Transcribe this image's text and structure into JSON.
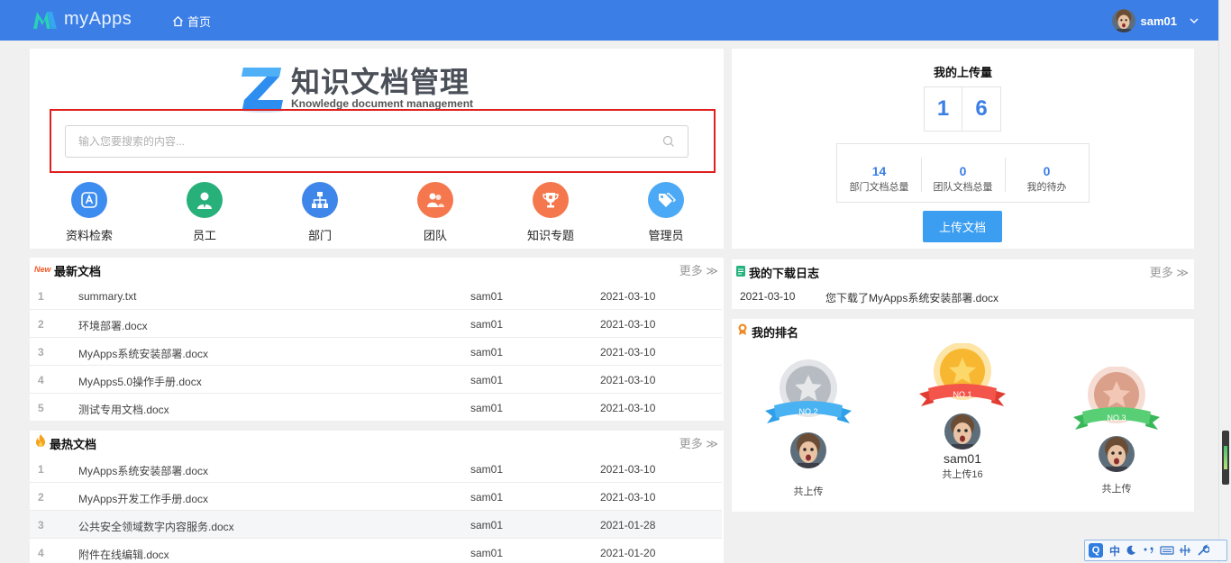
{
  "app": {
    "name": "myApps"
  },
  "nav": {
    "home": "首页"
  },
  "user": {
    "name": "sam01"
  },
  "brand": {
    "title": "知识文档管理",
    "subtitle": "Knowledge document management"
  },
  "search": {
    "placeholder": "输入您要搜索的内容..."
  },
  "categories": [
    {
      "label": "资料检索",
      "icon": "letter-a-icon",
      "color": "#3d8cef"
    },
    {
      "label": "员工",
      "icon": "employee-icon",
      "color": "#28b07a"
    },
    {
      "label": "部门",
      "icon": "org-chart-icon",
      "color": "#3f86ea"
    },
    {
      "label": "团队",
      "icon": "team-icon",
      "color": "#f4774d"
    },
    {
      "label": "知识专题",
      "icon": "trophy-icon",
      "color": "#f4774d"
    },
    {
      "label": "管理员",
      "icon": "tags-icon",
      "color": "#4ba9f5"
    }
  ],
  "upload": {
    "title": "我的上传量",
    "digits": [
      "1",
      "6"
    ],
    "stats": [
      {
        "value": "14",
        "label": "部门文档总量"
      },
      {
        "value": "0",
        "label": "团队文档总量"
      },
      {
        "value": "0",
        "label": "我的待办"
      }
    ],
    "button": "上传文档"
  },
  "latest": {
    "badge": "New",
    "title": "最新文档",
    "more": "更多",
    "rows": [
      {
        "idx": "1",
        "name": "summary.txt",
        "owner": "sam01",
        "date": "2021-03-10"
      },
      {
        "idx": "2",
        "name": "环境部署.docx",
        "owner": "sam01",
        "date": "2021-03-10"
      },
      {
        "idx": "3",
        "name": "MyApps系统安装部署.docx",
        "owner": "sam01",
        "date": "2021-03-10"
      },
      {
        "idx": "4",
        "name": "MyApps5.0操作手册.docx",
        "owner": "sam01",
        "date": "2021-03-10"
      },
      {
        "idx": "5",
        "name": "测试专用文档.docx",
        "owner": "sam01",
        "date": "2021-03-10"
      }
    ]
  },
  "hot": {
    "title": "最热文档",
    "more": "更多",
    "rows": [
      {
        "idx": "1",
        "name": "MyApps系统安装部署.docx",
        "owner": "sam01",
        "date": "2021-03-10"
      },
      {
        "idx": "2",
        "name": "MyApps开发工作手册.docx",
        "owner": "sam01",
        "date": "2021-03-10"
      },
      {
        "idx": "3",
        "name": "公共安全领域数字内容服务.docx",
        "owner": "sam01",
        "date": "2021-01-28"
      },
      {
        "idx": "4",
        "name": "附件在线编辑.docx",
        "owner": "sam01",
        "date": "2021-01-20"
      }
    ]
  },
  "download": {
    "title": "我的下载日志",
    "more": "更多",
    "entry": {
      "date": "2021-03-10",
      "text": "您下载了MyApps系统安装部署.docx"
    }
  },
  "ranking": {
    "title": "我的排名",
    "first": {
      "label": "NO.1",
      "name": "sam01",
      "count": "共上传16"
    },
    "second": {
      "label": "NO.2",
      "name": "",
      "count": "共上传"
    },
    "third": {
      "label": "NO.3",
      "name": "",
      "count": "共上传"
    }
  },
  "ime": {
    "mode": "中"
  }
}
